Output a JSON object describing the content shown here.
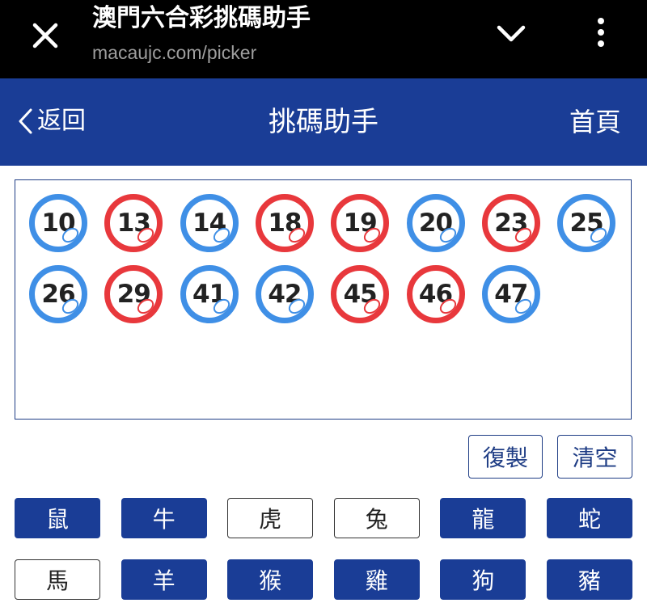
{
  "browser": {
    "title": "澳門六合彩挑碼助手",
    "url": "macaujc.com/picker"
  },
  "nav": {
    "back_label": "返回",
    "title": "挑碼助手",
    "home_label": "首頁"
  },
  "balls": [
    {
      "number": "10",
      "color": "blue"
    },
    {
      "number": "13",
      "color": "red"
    },
    {
      "number": "14",
      "color": "blue"
    },
    {
      "number": "18",
      "color": "red"
    },
    {
      "number": "19",
      "color": "red"
    },
    {
      "number": "20",
      "color": "blue"
    },
    {
      "number": "23",
      "color": "red"
    },
    {
      "number": "25",
      "color": "blue"
    },
    {
      "number": "26",
      "color": "blue"
    },
    {
      "number": "29",
      "color": "red"
    },
    {
      "number": "41",
      "color": "blue"
    },
    {
      "number": "42",
      "color": "blue"
    },
    {
      "number": "45",
      "color": "red"
    },
    {
      "number": "46",
      "color": "red"
    },
    {
      "number": "47",
      "color": "blue"
    }
  ],
  "actions": {
    "copy_label": "復製",
    "clear_label": "清空"
  },
  "zodiac": [
    {
      "label": "鼠",
      "selected": true
    },
    {
      "label": "牛",
      "selected": true
    },
    {
      "label": "虎",
      "selected": false
    },
    {
      "label": "兔",
      "selected": false
    },
    {
      "label": "龍",
      "selected": true
    },
    {
      "label": "蛇",
      "selected": true
    },
    {
      "label": "馬",
      "selected": false
    },
    {
      "label": "羊",
      "selected": true
    },
    {
      "label": "猴",
      "selected": true
    },
    {
      "label": "雞",
      "selected": true
    },
    {
      "label": "狗",
      "selected": true
    },
    {
      "label": "豬",
      "selected": true
    }
  ],
  "colors": {
    "blue_ball": "#3f8fe6",
    "red_ball": "#e8383c",
    "nav_bg": "#1a3d96"
  }
}
